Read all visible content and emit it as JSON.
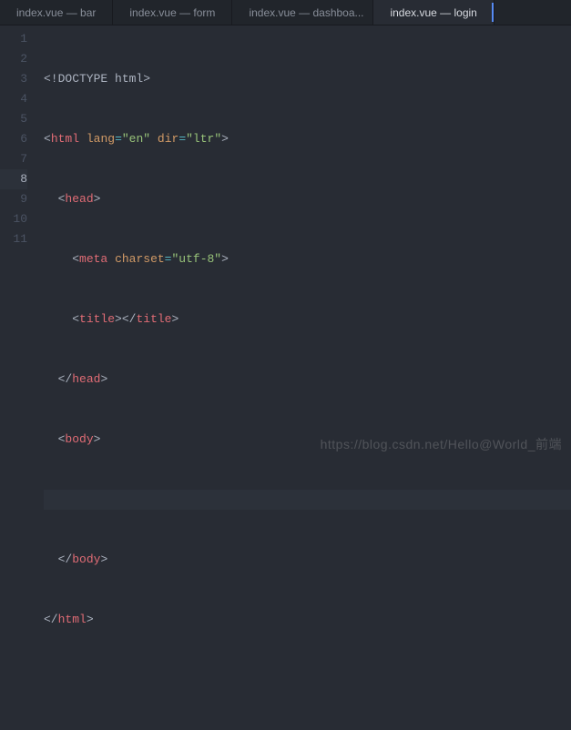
{
  "tabs": [
    {
      "label": "index.vue — bar",
      "active": false
    },
    {
      "label": "index.vue — form",
      "active": false
    },
    {
      "label": "index.vue — dashboa...",
      "active": false
    },
    {
      "label": "index.vue — login",
      "active": true
    }
  ],
  "gutter": [
    "1",
    "2",
    "3",
    "4",
    "5",
    "6",
    "7",
    "8",
    "9",
    "10",
    "11"
  ],
  "active_line": 8,
  "code": {
    "l1_doctype": "<!DOCTYPE html>",
    "l2": {
      "open": "<",
      "tag": "html",
      "sp1": " ",
      "a1": "lang",
      "eq": "=",
      "v1": "\"en\"",
      "sp2": " ",
      "a2": "dir",
      "v2": "\"ltr\"",
      "close": ">"
    },
    "l3": {
      "open": "<",
      "tag": "head",
      "close": ">"
    },
    "l4": {
      "open": "<",
      "tag": "meta",
      "sp": " ",
      "a1": "charset",
      "eq": "=",
      "v1": "\"utf-8\"",
      "close": ">"
    },
    "l5": {
      "open1": "<",
      "tag1": "title",
      "close1": ">",
      "open2": "</",
      "tag2": "title",
      "close2": ">"
    },
    "l6": {
      "open": "</",
      "tag": "head",
      "close": ">"
    },
    "l7": {
      "open": "<",
      "tag": "body",
      "close": ">"
    },
    "l9": {
      "open": "</",
      "tag": "body",
      "close": ">"
    },
    "l10": {
      "open": "</",
      "tag": "html",
      "close": ">"
    }
  },
  "indent": {
    "i1": "  ",
    "i2": "    ",
    "i3": "      "
  },
  "watermark": "https://blog.csdn.net/Hello@World_前端"
}
